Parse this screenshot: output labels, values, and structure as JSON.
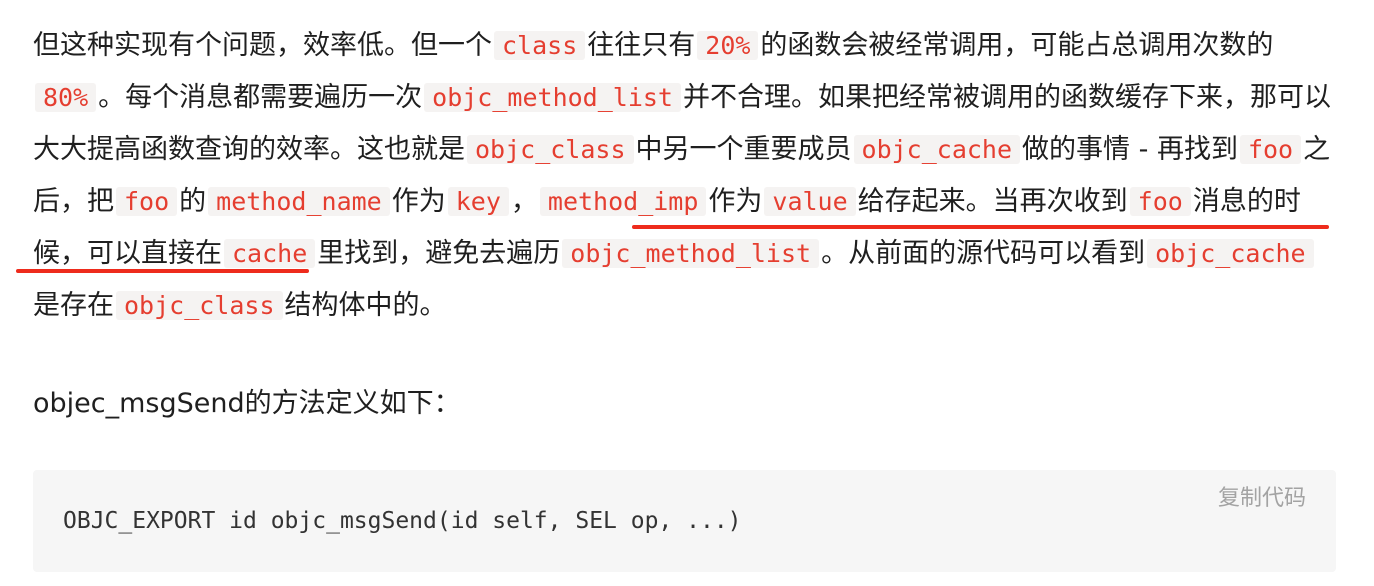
{
  "paragraph1": {
    "s1": "但这种实现有个问题，效率低。但一个",
    "c1": "class",
    "s2": "往往只有",
    "c2": "20%",
    "s3": "的函数会被经常调用，可能占总调用次数的",
    "c3": "80%",
    "s4": "。每个消息都需要遍历一次",
    "c4": "objc_method_list",
    "s5": "并不合理。如果把经常被调用的函数缓存下来，那可以大大提高函数查询的效率。这也就是",
    "c5": "objc_class",
    "s6": "中另一个重要成员",
    "c6": "objc_cache",
    "s7": "做的事情 - 再找到",
    "c7": "foo",
    "s8": "之后，把",
    "c8": "foo",
    "s9": "的",
    "c9": "method_name",
    "s10": "作为",
    "c10": "key",
    "s11": "，",
    "c11": "method_imp",
    "s12": "作为",
    "c12": "value",
    "s13": "给存起来。",
    "s14": "当再次收到",
    "c13": "foo",
    "s15": "消息的时候，可以直接在",
    "c14": "cache",
    "s16": "里找到，避免去遍历",
    "c15": "objc_method_list",
    "s17": "。从前面的源代码可以看到",
    "c16": "objc_cache",
    "s18": "是存在",
    "c17": "objc_class",
    "s19": "结构体中的。"
  },
  "paragraph2": "objec_msgSend的方法定义如下：",
  "code_block": {
    "copy_label": "复制代码",
    "code": "OBJC_EXPORT id objc_msgSend(id self, SEL op, ...)"
  },
  "colors": {
    "inline_code": "#e53e30",
    "inline_code_bg": "#f5f3f2",
    "underline": "#ee2b1c",
    "code_block_bg": "#f6f6f6"
  }
}
